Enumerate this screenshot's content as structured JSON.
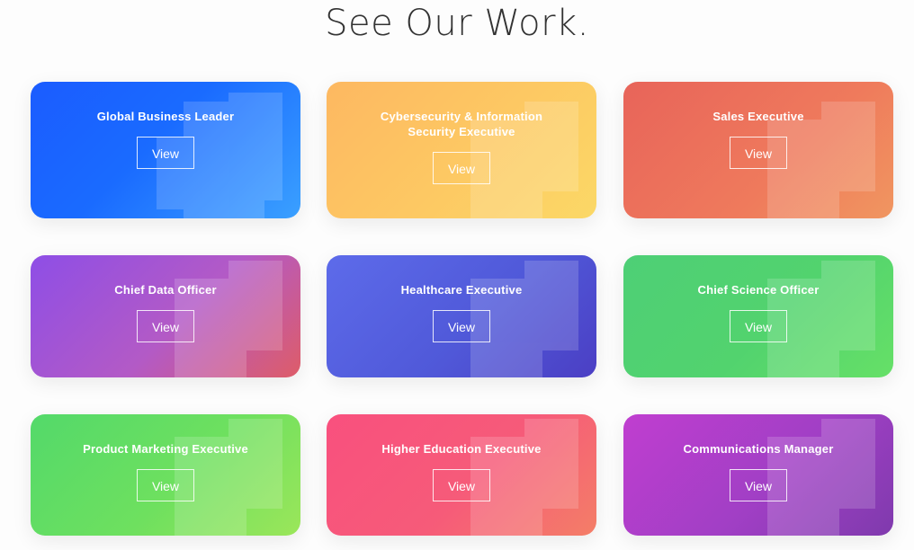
{
  "header": {
    "title": "See Our Work."
  },
  "cards": [
    {
      "title": "Global Business Leader",
      "button_label": "View",
      "gradient": "#1b5cff"
    },
    {
      "title": "Cybersecurity & Information Security Executive",
      "button_label": "View",
      "gradient": "#fdb861"
    },
    {
      "title": "Sales Executive",
      "button_label": "View",
      "gradient": "#e8645a"
    },
    {
      "title": "Chief Data Officer",
      "button_label": "View",
      "gradient": "#8e4ee6"
    },
    {
      "title": "Healthcare Executive",
      "button_label": "View",
      "gradient": "#5d6bea"
    },
    {
      "title": "Chief Science Officer",
      "button_label": "View",
      "gradient": "#4ecf76"
    },
    {
      "title": "Product Marketing Executive",
      "button_label": "View",
      "gradient": "#53d96a"
    },
    {
      "title": "Higher Education Executive",
      "button_label": "View",
      "gradient": "#f9507e"
    },
    {
      "title": "Communications Manager",
      "button_label": "View",
      "gradient": "#c03ed0"
    }
  ]
}
